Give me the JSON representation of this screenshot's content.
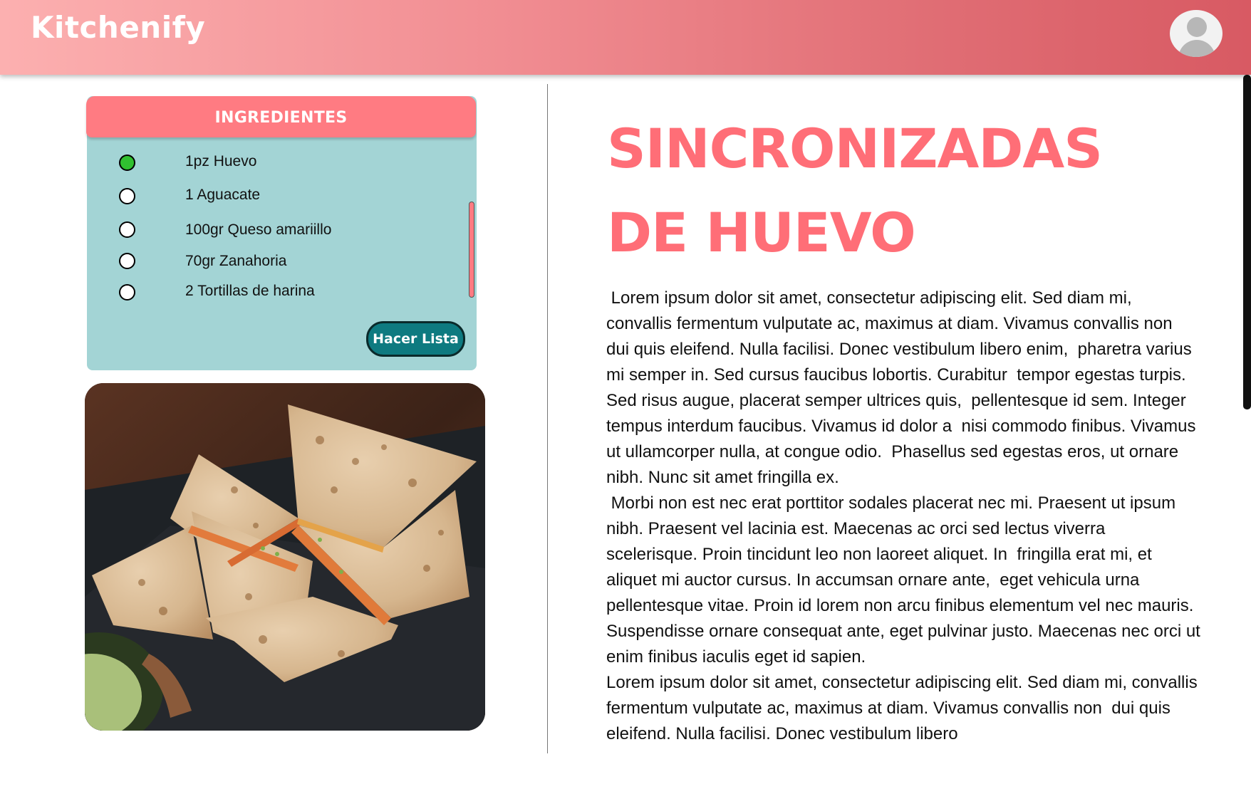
{
  "app": {
    "brand": "Kitchenify"
  },
  "ingredients": {
    "title": "INGREDIENTES",
    "items": [
      {
        "label": "1pz Huevo",
        "checked": true
      },
      {
        "label": "1 Aguacate",
        "checked": false
      },
      {
        "label": "100gr Queso amariillo",
        "checked": false
      },
      {
        "label": "70gr Zanahoria",
        "checked": false
      },
      {
        "label": "2 Tortillas de harina",
        "checked": false
      }
    ],
    "button_label": "Hacer Lista"
  },
  "recipe": {
    "title_line1": "SINCRONIZADAS",
    "title_line2": "DE HUEVO",
    "paragraphs": [
      " Lorem ipsum dolor sit amet, consectetur adipiscing elit. Sed diam mi, convallis fermentum vulputate ac, maximus at diam. Vivamus convallis non  dui quis eleifend. Nulla facilisi. Donec vestibulum libero enim,  pharetra varius mi semper in. Sed cursus faucibus lobortis. Curabitur  tempor egestas turpis. Sed risus augue, placerat semper ultrices quis,  pellentesque id sem. Integer tempus interdum faucibus. Vivamus id dolor a  nisi commodo finibus. Vivamus ut ullamcorper nulla, at congue odio.  Phasellus sed egestas eros, ut ornare nibh. Nunc sit amet fringilla ex.",
      " Morbi non est nec erat porttitor sodales placerat nec mi. Praesent ut ipsum nibh. Praesent vel lacinia est. Maecenas ac orci sed lectus viverra scelerisque. Proin tincidunt leo non laoreet aliquet. In  fringilla erat mi, et aliquet mi auctor cursus. In accumsan ornare ante,  eget vehicula urna pellentesque vitae. Proin id lorem non arcu finibus elementum vel nec mauris. Suspendisse ornare consequat ante, eget pulvinar justo. Maecenas nec orci ut enim finibus iaculis eget id sapien.",
      "Lorem ipsum dolor sit amet, consectetur adipiscing elit. Sed diam mi, convallis fermentum vulputate ac, maximus at diam. Vivamus convallis non  dui quis eleifend. Nulla facilisi. Donec vestibulum libero"
    ]
  },
  "colors": {
    "header_gradient_start": "#fcb0b0",
    "header_gradient_end": "#d85a63",
    "accent_coral": "#ff6e77",
    "ingredients_bg": "#a3d4d5",
    "button_teal": "#0e7a80",
    "checked_green": "#30c030"
  },
  "icons": {
    "avatar": "user-avatar-icon",
    "radio_checked": "radio-checked-icon",
    "radio_unchecked": "radio-unchecked-icon"
  }
}
